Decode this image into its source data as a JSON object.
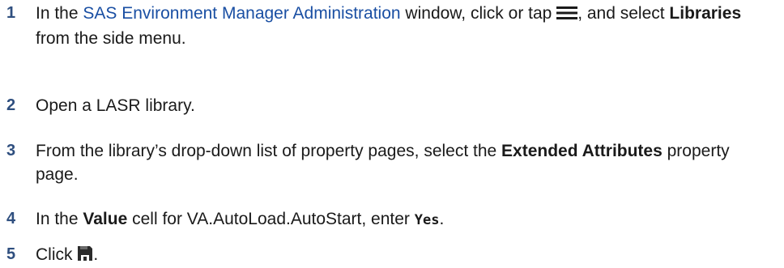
{
  "steps": [
    {
      "number": "1",
      "pre": "In the ",
      "link": "SAS Environment Manager Administration",
      "mid": " window, click or tap ",
      "icon": "hamburger-menu-icon",
      "after_icon": ", and select ",
      "bold": "Libraries",
      "post": " from the side menu."
    },
    {
      "number": "2",
      "text": "Open a LASR library."
    },
    {
      "number": "3",
      "pre": "From the library’s drop-down list of property pages, select the ",
      "bold": "Extended Attributes",
      "post": " property page."
    },
    {
      "number": "4",
      "pre": "In the ",
      "bold": "Value",
      "mid": " cell for VA.AutoLoad.AutoStart, enter ",
      "code": "Yes",
      "post": "."
    },
    {
      "number": "5",
      "pre": "Click ",
      "icon": "save-icon",
      "post": "."
    }
  ],
  "colors": {
    "step_number": "#2f4f7f",
    "link": "#1a4fa3",
    "text": "#1a1a1a"
  }
}
